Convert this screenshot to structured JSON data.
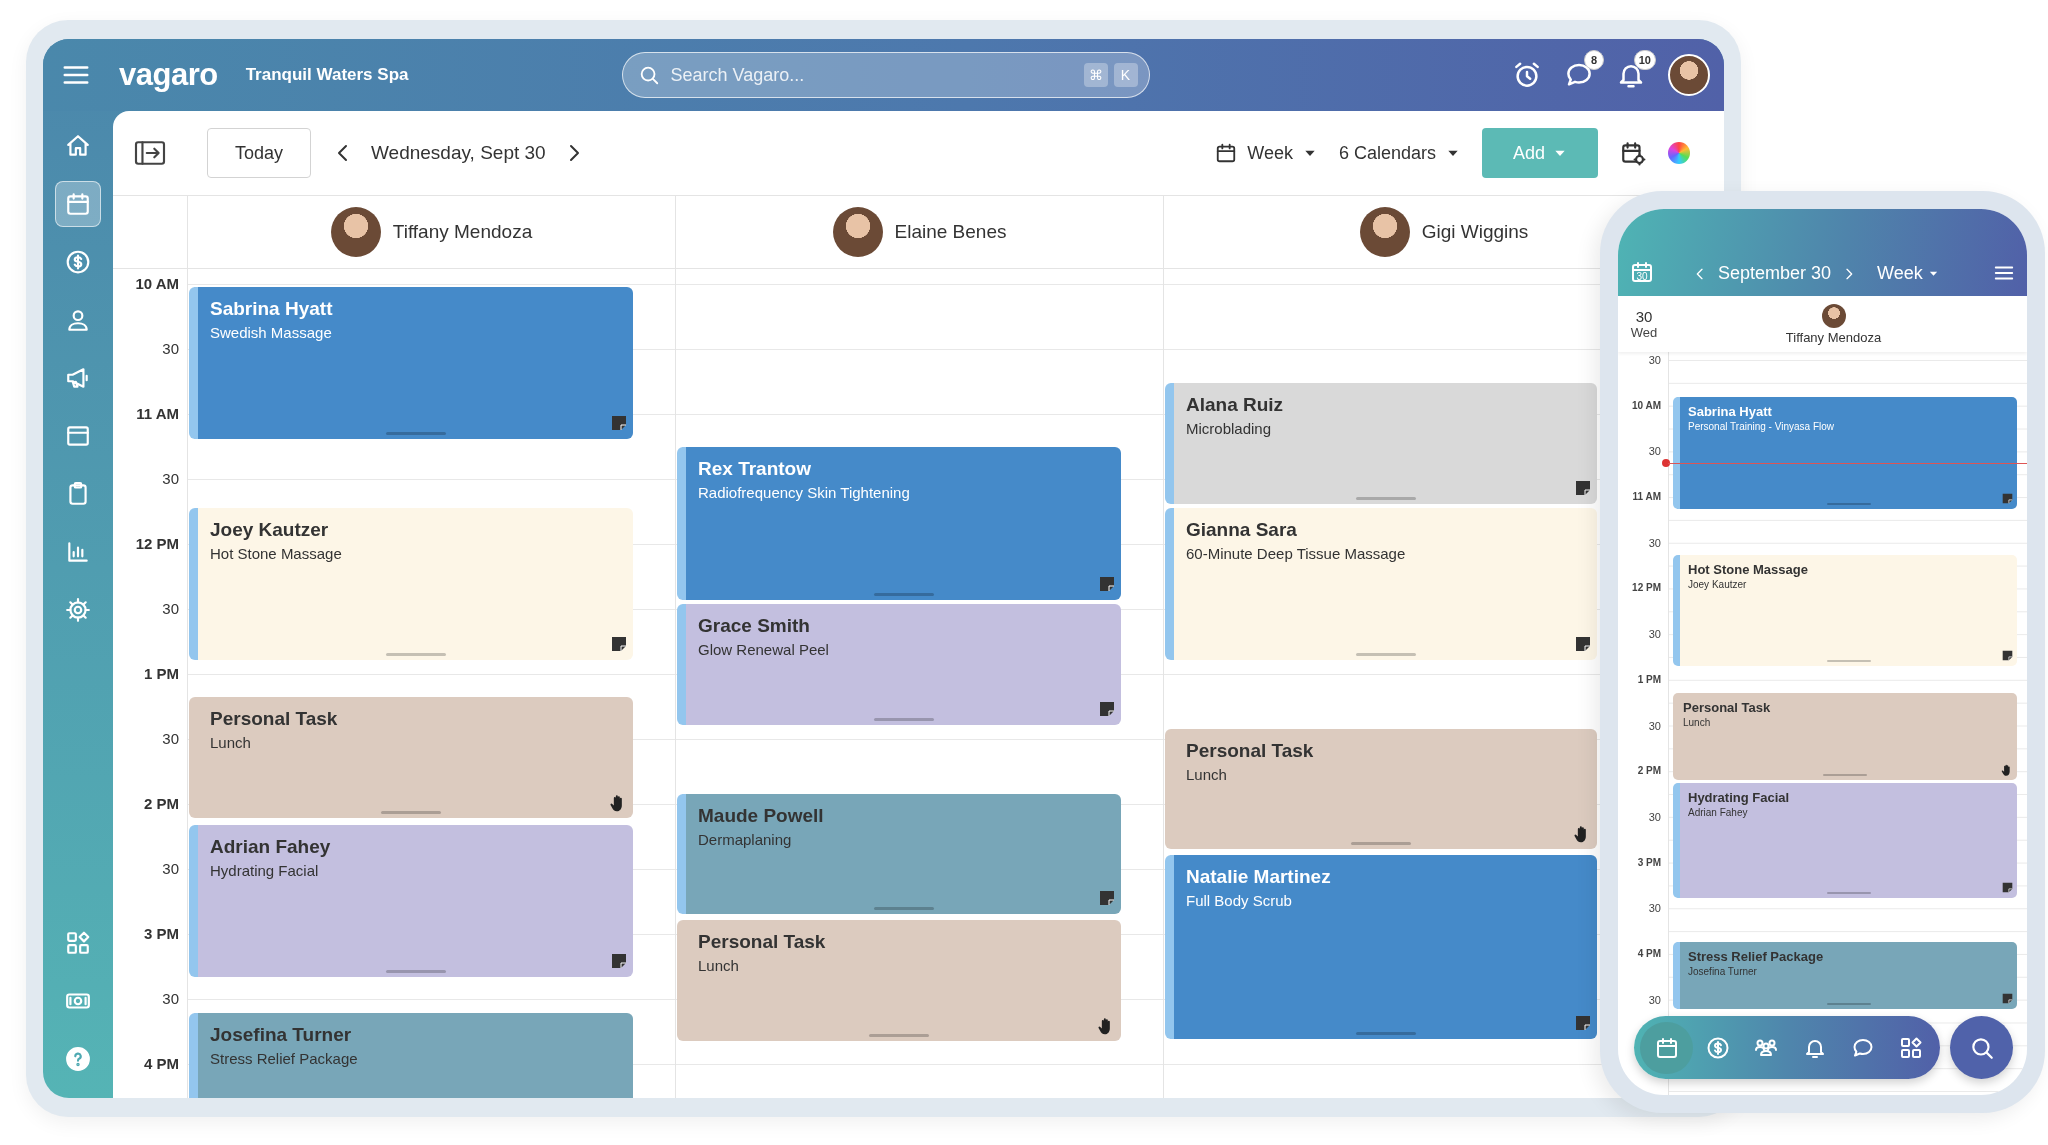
{
  "topbar": {
    "logo": "vagaro",
    "business": "Tranquil Waters Spa",
    "search": {
      "placeholder": "Search Vagaro..."
    },
    "shortcut_keys": [
      "⌘",
      "K"
    ],
    "message_badge": "8",
    "notification_badge": "10"
  },
  "sidebar": {
    "items": [
      {
        "selected": false
      },
      {
        "selected": true
      },
      {
        "selected": false
      },
      {
        "selected": false
      },
      {
        "selected": false
      },
      {
        "selected": false
      },
      {
        "selected": false
      },
      {
        "selected": false
      },
      {
        "selected": false
      }
    ],
    "bottom_items": [
      {
        "selected": false
      },
      {
        "selected": false
      },
      {
        "selected": false
      }
    ]
  },
  "toolbar": {
    "today": "Today",
    "date": "Wednesday, Sept 30",
    "view": "Week",
    "calendars": "6 Calendars",
    "add": "Add"
  },
  "staff": [
    {
      "name": "Tiffany Mendoza"
    },
    {
      "name": "Elaine Benes"
    },
    {
      "name": "Gigi Wiggins"
    }
  ],
  "time_labels": [
    "10 AM",
    "30",
    "11 AM",
    "30",
    "12 PM",
    "30",
    "1 PM",
    "30",
    "2 PM",
    "30",
    "3 PM",
    "30",
    "4 PM"
  ],
  "columns": [
    {
      "events": [
        {
          "name": "Sabrina Hyatt",
          "service": "Swedish Massage",
          "kind": "appointment",
          "color": "#458ac9"
        },
        {
          "name": "Joey Kautzer",
          "service": "Hot Stone Massage",
          "kind": "appointment",
          "color": "#fdf6e7"
        },
        {
          "name": "Personal Task",
          "service": "Lunch",
          "kind": "task",
          "color": "#dccbbf"
        },
        {
          "name": "Adrian Fahey",
          "service": "Hydrating Facial",
          "kind": "appointment",
          "color": "#c3bfdf"
        },
        {
          "name": "Josefina Turner",
          "service": "Stress Relief Package",
          "kind": "appointment",
          "color": "#78a6b8"
        }
      ]
    },
    {
      "events": [
        {
          "name": "Rex Trantow",
          "service": "Radiofrequency Skin Tightening",
          "kind": "appointment",
          "color": "#458ac9"
        },
        {
          "name": "Grace Smith",
          "service": "Glow Renewal Peel",
          "kind": "appointment",
          "color": "#c3bfdf"
        },
        {
          "name": "Maude Powell",
          "service": "Dermaplaning",
          "kind": "appointment",
          "color": "#78a6b8"
        },
        {
          "name": "Personal Task",
          "service": "Lunch",
          "kind": "task",
          "color": "#dccbbf"
        }
      ]
    },
    {
      "events": [
        {
          "name": "Alana Ruiz",
          "service": "Microblading",
          "kind": "appointment",
          "color": "#d9d9d9"
        },
        {
          "name": "Gianna Sara",
          "service": "60-Minute Deep Tissue Massage",
          "kind": "appointment",
          "color": "#fdf6e7"
        },
        {
          "name": "Personal Task",
          "service": "Lunch",
          "kind": "task",
          "color": "#dccbbf"
        },
        {
          "name": "Natalie Martinez",
          "service": "Full Body Scrub",
          "kind": "appointment",
          "color": "#458ac9"
        }
      ]
    }
  ],
  "phone": {
    "calendar_badge": "30",
    "date": "September 30",
    "view": "Week",
    "day_number": "30",
    "day_name": "Wed",
    "staff_name": "Tiffany Mendoza",
    "time_labels": [
      "30",
      "10 AM",
      "30",
      "11 AM",
      "30",
      "12 PM",
      "30",
      "1 PM",
      "30",
      "2 PM",
      "30",
      "3 PM",
      "30",
      "4 PM",
      "30"
    ],
    "events": [
      {
        "name": "Sabrina Hyatt",
        "service": "Personal Training - Vinyasa Flow",
        "kind": "appointment",
        "color": "#458ac9"
      },
      {
        "name": "Hot Stone Massage",
        "service": "Joey Kautzer",
        "kind": "appointment",
        "color": "#fdf6e7"
      },
      {
        "name": "Personal Task",
        "service": "Lunch",
        "kind": "task",
        "color": "#dccbbf"
      },
      {
        "name": "Hydrating Facial",
        "service": "Adrian Fahey",
        "kind": "appointment",
        "color": "#c3bfdf"
      },
      {
        "name": "Stress Relief Package",
        "service": "Josefina Turner",
        "kind": "appointment",
        "color": "#78a6b8"
      }
    ],
    "nav": [
      {
        "selected": true
      },
      {
        "selected": false
      },
      {
        "selected": false
      },
      {
        "selected": false
      },
      {
        "selected": false
      },
      {
        "selected": false
      }
    ]
  }
}
